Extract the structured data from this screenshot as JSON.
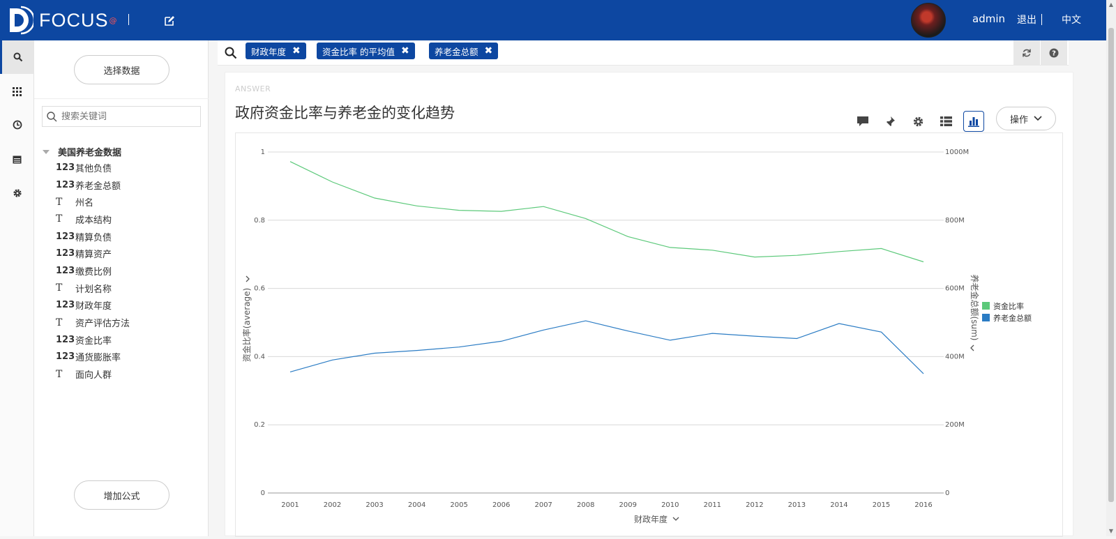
{
  "app": {
    "brand": "FOCUS",
    "brand_sup": "@",
    "user": "admin",
    "logout": "退出",
    "language": "中文"
  },
  "iconbar": [
    "search-icon",
    "apps-grid-icon",
    "history-clock-icon",
    "calendar-icon",
    "settings-gear-icon"
  ],
  "sidebar": {
    "select_data_label": "选择数据",
    "search_placeholder": "搜索关键词",
    "datasource": "美国养老金数据",
    "fields": [
      {
        "type": "123",
        "name": "其他负债"
      },
      {
        "type": "123",
        "name": "养老金总额"
      },
      {
        "type": "T",
        "name": "州名"
      },
      {
        "type": "T",
        "name": "成本结构"
      },
      {
        "type": "123",
        "name": "精算负债"
      },
      {
        "type": "123",
        "name": "精算资产"
      },
      {
        "type": "123",
        "name": "缴费比例"
      },
      {
        "type": "T",
        "name": "计划名称"
      },
      {
        "type": "123",
        "name": "财政年度"
      },
      {
        "type": "T",
        "name": "资产评估方法"
      },
      {
        "type": "123",
        "name": "资金比率"
      },
      {
        "type": "123",
        "name": "通货膨胀率"
      },
      {
        "type": "T",
        "name": "面向人群"
      }
    ],
    "add_formula_label": "增加公式"
  },
  "query": {
    "tags": [
      "财政年度",
      "资金比率 的平均值",
      "养老金总额"
    ],
    "tag_close": "✖"
  },
  "answer": {
    "label": "ANSWER",
    "title": "政府资金比率与养老金的变化趋势",
    "ops_label": "操作"
  },
  "colors": {
    "brand_blue": "#0d47a1",
    "series_green": "#5cc97a",
    "series_blue": "#2b7cc4"
  },
  "chart_data": {
    "type": "line",
    "x": [
      2001,
      2002,
      2003,
      2004,
      2005,
      2006,
      2007,
      2008,
      2009,
      2010,
      2011,
      2012,
      2013,
      2014,
      2015,
      2016
    ],
    "xlabel": "财政年度",
    "ylabel_left": "资金比率(average)",
    "ylabel_right": "养老金总额(sum)",
    "yticks_left": [
      "0",
      "0.2",
      "0.4",
      "0.6",
      "0.8",
      "1"
    ],
    "yticks_right": [
      "0",
      "200M",
      "400M",
      "600M",
      "800M",
      "1000M"
    ],
    "ylim_left": [
      0,
      1
    ],
    "ylim_right": [
      0,
      1000000000
    ],
    "grid": true,
    "legend_position": "right",
    "series": [
      {
        "name": "资金比率",
        "axis": "left",
        "color": "#5cc97a",
        "values": [
          0.972,
          0.912,
          0.865,
          0.842,
          0.829,
          0.826,
          0.84,
          0.805,
          0.752,
          0.72,
          0.712,
          0.692,
          0.697,
          0.708,
          0.717,
          0.678
        ]
      },
      {
        "name": "养老金总额",
        "axis": "right",
        "color": "#2b7cc4",
        "values": [
          355000000,
          390000000,
          410000000,
          418000000,
          428000000,
          445000000,
          478000000,
          505000000,
          475000000,
          448000000,
          468000000,
          460000000,
          453000000,
          497000000,
          472000000,
          350000000
        ]
      }
    ]
  }
}
